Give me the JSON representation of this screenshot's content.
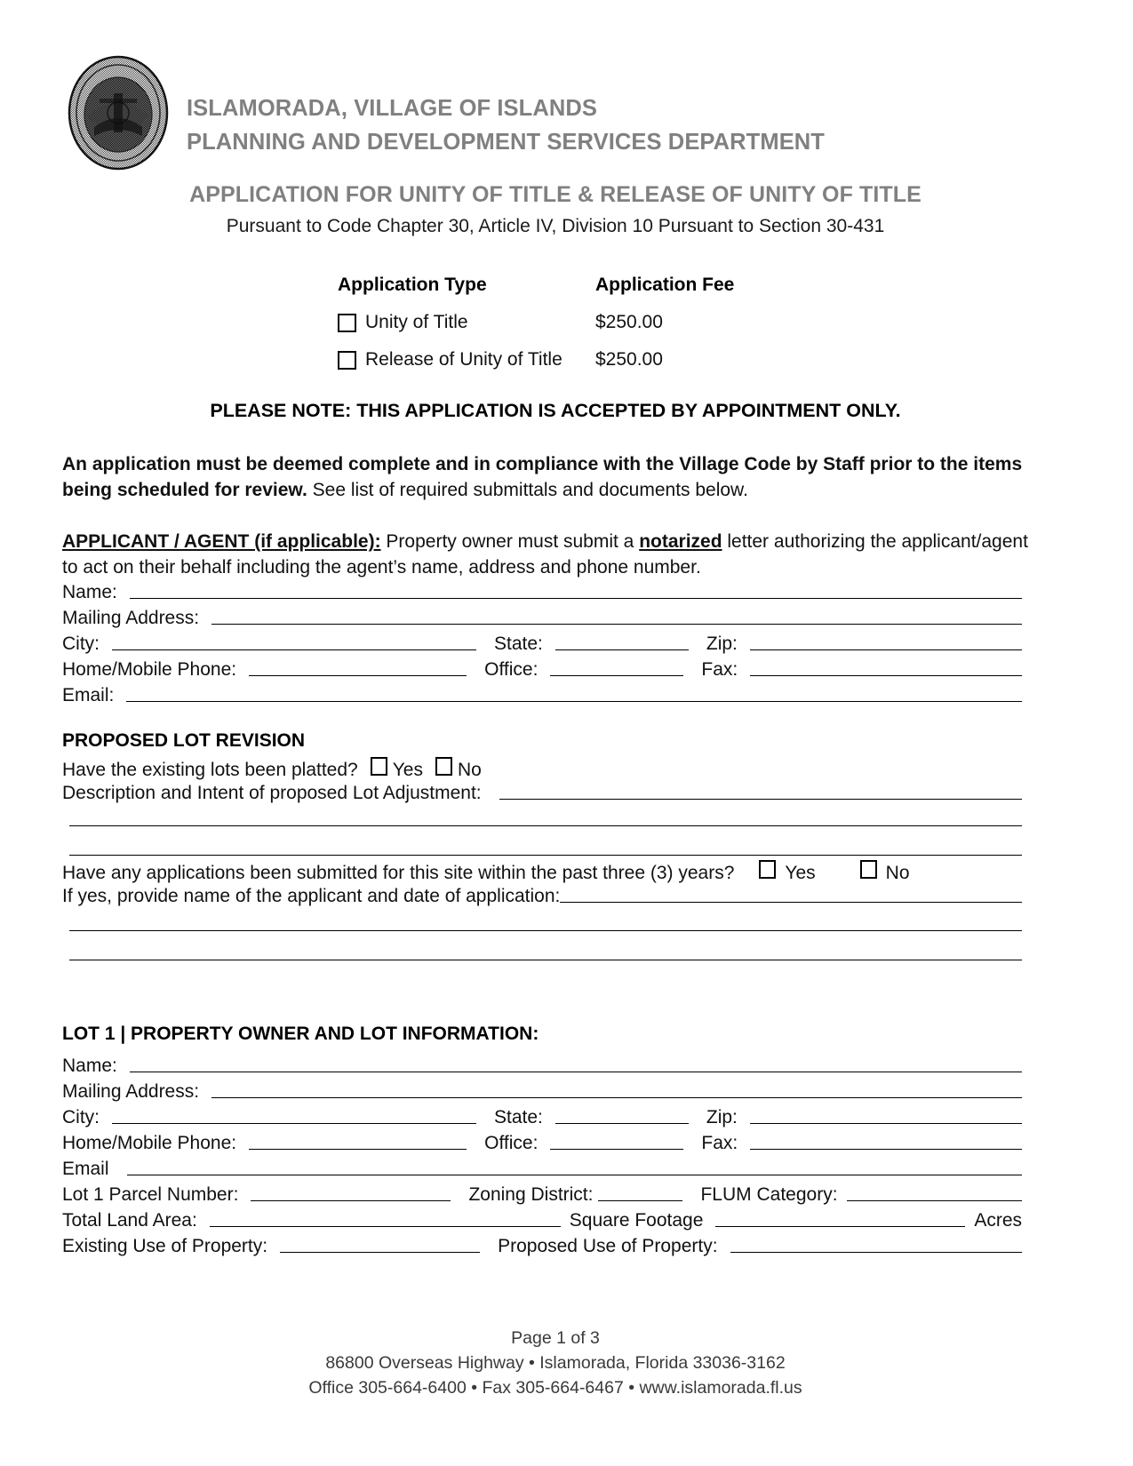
{
  "header": {
    "seal_alt": "village-seal",
    "org_line1": "ISLAMORADA, VILLAGE OF ISLANDS",
    "org_line2": "PLANNING AND DEVELOPMENT SERVICES DEPARTMENT",
    "title": "APPLICATION FOR UNITY OF TITLE & RELEASE OF UNITY OF TITLE",
    "subtitle": "Pursuant to Code Chapter 30, Article IV, Division 10 Pursuant to Section 30-431",
    "title_color": "#808080"
  },
  "application_table": {
    "col1_header": "Application Type",
    "col2_header": "Application Fee",
    "rows": [
      {
        "type": "Unity of Title",
        "fee": "$250.00"
      },
      {
        "type": "Release of Unity of Title",
        "fee": "$250.00"
      }
    ]
  },
  "notices": {
    "appointment_only": "PLEASE NOTE: THIS APPLICATION IS ACCEPTED BY APPOINTMENT ONLY.",
    "compliance_bold": "An application must be deemed complete and in compliance with the Village Code by Staff prior to the items being scheduled for review.",
    "compliance_rest": " See list of required submittals and documents below.",
    "applicant_label": "APPLICANT / AGENT (if applicable):",
    "applicant_text_1": " Property owner must submit a ",
    "applicant_emphasis": "notarized",
    "applicant_text_2": " letter authorizing the applicant/agent to act on their behalf including the agent’s name, address and phone number."
  },
  "applicant_fields": {
    "name": "Name:",
    "mailing_address": "Mailing Address:",
    "city": "City:",
    "state": "State:",
    "zip": "Zip:",
    "home_mobile_phone": "Home/Mobile Phone:",
    "office": "Office:",
    "fax": "Fax:",
    "email": "Email:"
  },
  "lot_revision": {
    "heading": "PROPOSED LOT REVISION",
    "platted_question": "Have the existing lots been platted?",
    "yes": "Yes",
    "no": "No",
    "description_label": "Description and Intent of proposed Lot Adjustment:",
    "prior_apps_question": "Have any applications been submitted for this site within the past three (3) years?",
    "prior_apps_yes": "Yes",
    "prior_apps_no": "No",
    "if_yes_label": "If yes, provide name of the applicant and date of application:"
  },
  "lot1": {
    "heading": "LOT 1 | PROPERTY OWNER AND LOT INFORMATION:",
    "name": "Name:",
    "mailing_address": "Mailing Address:",
    "city": "City:",
    "state": "State:",
    "zip": "Zip:",
    "home_mobile_phone": "Home/Mobile Phone:",
    "office": "Office:",
    "fax": "Fax:",
    "email": "Email",
    "parcel_number": "Lot 1 Parcel Number:",
    "zoning_district": "Zoning District:",
    "flum_category": "FLUM Category:",
    "total_land_area": "Total Land Area:",
    "square_footage": "Square Footage",
    "acres": "Acres",
    "existing_use": "Existing Use of Property:",
    "proposed_use": "Proposed Use of Property:"
  },
  "footer": {
    "page": "Page 1 of 3",
    "address": "86800 Overseas Highway  •  Islamorada, Florida 33036-3162",
    "contact": "Office 305-664-6400  •  Fax 305-664-6467  •  www.islamorada.fl.us"
  }
}
